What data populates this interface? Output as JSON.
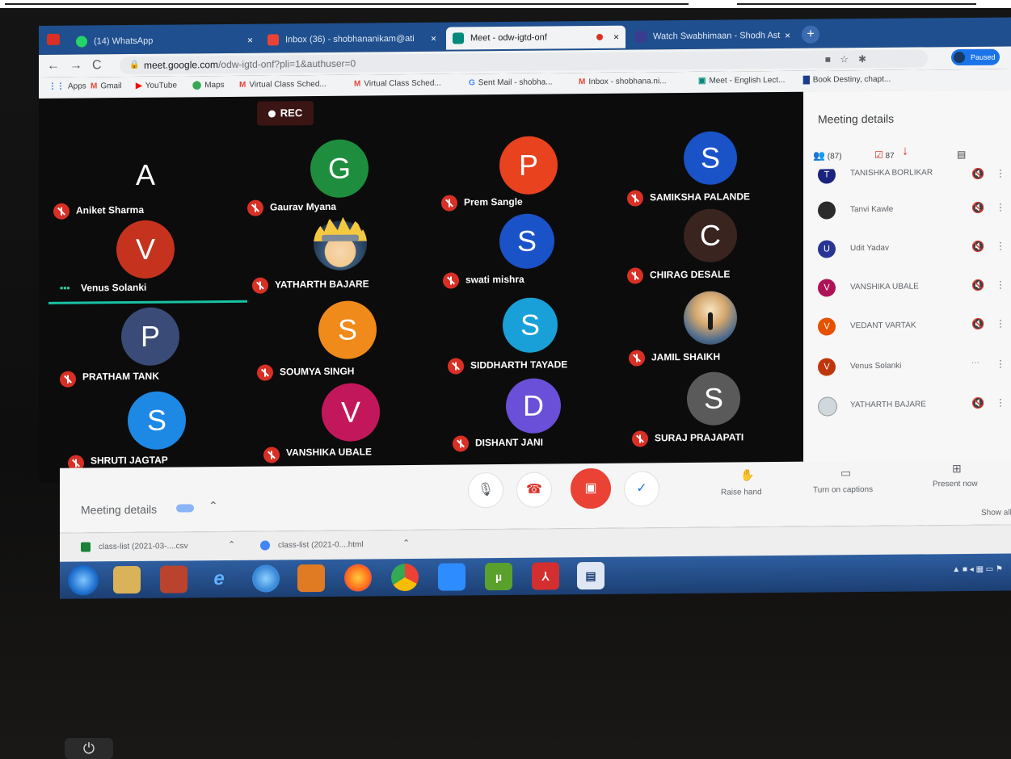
{
  "browser": {
    "tabs": [
      {
        "label": "(14) WhatsApp",
        "close": "×",
        "icon_color": "#25d366"
      },
      {
        "label": "Inbox (36) - shobhananikam@ati",
        "close": "×",
        "icon_color": "#ea4335"
      },
      {
        "label": "Meet - odw-igtd-onf",
        "close": "×",
        "icon_color": "#00897b"
      },
      {
        "label": "Watch Swabhimaan - Shodh Ast",
        "close": "×",
        "icon_color": "#3b3b8f"
      }
    ],
    "new_tab": "+",
    "url_host": "meet.google.com",
    "url_path": "/odw-igtd-onf?pli=1&authuser=0",
    "profile_label": "Paused",
    "bookmarks": [
      {
        "icon": "apps-icon",
        "glyph": "⋮⋮",
        "label": "Apps"
      },
      {
        "icon": "gmail-icon",
        "glyph": "M",
        "label": "Gmail"
      },
      {
        "icon": "youtube-icon",
        "glyph": "▶",
        "label": "YouTube"
      },
      {
        "icon": "maps-icon",
        "glyph": "⬤",
        "label": "Maps"
      },
      {
        "icon": "gmail-icon",
        "glyph": "M",
        "label": "Virtual Class Sched..."
      },
      {
        "icon": "gmail-icon",
        "glyph": "M",
        "label": "Virtual Class Sched..."
      },
      {
        "icon": "google-icon",
        "glyph": "G",
        "label": "Sent Mail - shobha..."
      },
      {
        "icon": "gmail-icon",
        "glyph": "M",
        "label": "Inbox - shobhana.ni..."
      },
      {
        "icon": "meet-icon",
        "glyph": "▣",
        "label": "Meet - English Lect..."
      },
      {
        "icon": "book-icon",
        "glyph": "▇",
        "label": "Book Destiny, chapt..."
      }
    ]
  },
  "meet": {
    "rec_label": "REC",
    "participants": [
      {
        "name": "Aniket Sharma",
        "initial": "A",
        "color": "#0c0c0c"
      },
      {
        "name": "Gaurav Myana",
        "initial": "G",
        "color": "#1e8e3e"
      },
      {
        "name": "Prem Sangle",
        "initial": "P",
        "color": "#e8421e"
      },
      {
        "name": "SAMIKSHA PALANDE",
        "initial": "S",
        "color": "#1a52c8"
      },
      {
        "name": "Venus Solanki",
        "initial": "V",
        "color": "#c5331f"
      },
      {
        "name": "YATHARTH BAJARE",
        "initial": "",
        "color": "#0c0c0c"
      },
      {
        "name": "swati mishra",
        "initial": "S",
        "color": "#1a52c8"
      },
      {
        "name": "CHIRAG DESALE",
        "initial": "C",
        "color": "#3a2420"
      },
      {
        "name": "PRATHAM TANK",
        "initial": "P",
        "color": "#3a4b78"
      },
      {
        "name": "SOUMYA SINGH",
        "initial": "S",
        "color": "#f08a1a"
      },
      {
        "name": "SIDDHARTH TAYADE",
        "initial": "S",
        "color": "#1aa0d8"
      },
      {
        "name": "JAMIL SHAIKH",
        "initial": "",
        "color": "#0c0c0c"
      },
      {
        "name": "SHRUTI JAGTAP",
        "initial": "S",
        "color": "#1e88e5"
      },
      {
        "name": "VANSHIKA UBALE",
        "initial": "V",
        "color": "#c2185b"
      },
      {
        "name": "DISHANT JANI",
        "initial": "D",
        "color": "#6a4fd8"
      },
      {
        "name": "SURAJ PRAJAPATI",
        "initial": "S",
        "color": "#5a5a5a"
      }
    ],
    "speaking_dots": "•••"
  },
  "panel": {
    "title": "Meeting details",
    "people_count": "(87)",
    "activities_count": "87",
    "rows": [
      {
        "name": "TANISHKA BORLIKAR",
        "initial": "T",
        "color": "#1a237e"
      },
      {
        "name": "Tanvi Kawle",
        "initial": "",
        "color": "#2b2b2b"
      },
      {
        "name": "Udit Yadav",
        "initial": "U",
        "color": "#283593"
      },
      {
        "name": "VANSHIKA UBALE",
        "initial": "V",
        "color": "#ad1457"
      },
      {
        "name": "VEDANT VARTAK",
        "initial": "V",
        "color": "#e65100"
      },
      {
        "name": "Venus Solanki",
        "initial": "V",
        "color": "#bf360c"
      },
      {
        "name": "YATHARTH BAJARE",
        "initial": "",
        "color": "#cfd8dc"
      }
    ],
    "more_label": "Show all"
  },
  "controls": {
    "meeting_details": "Meeting details",
    "raise_hand": "Raise hand",
    "captions": "Turn on captions",
    "present": "Present now"
  },
  "downloads": [
    {
      "label": "class-list (2021-03-....csv",
      "icon_color": "#188038"
    },
    {
      "label": "class-list (2021-0....html",
      "icon_color": "#4285f4"
    }
  ]
}
